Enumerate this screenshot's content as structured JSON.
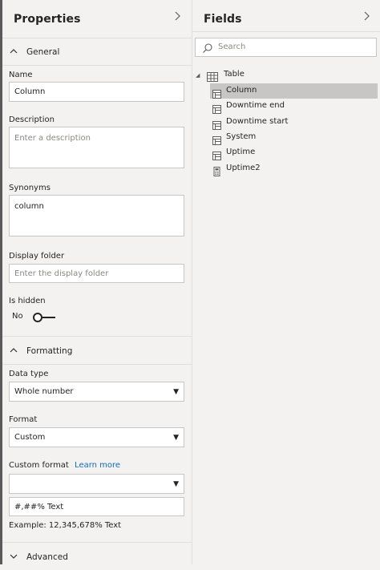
{
  "properties": {
    "title": "Properties",
    "general": {
      "header": "General",
      "name_label": "Name",
      "name_value": "Column",
      "description_label": "Description",
      "description_placeholder": "Enter a description",
      "synonyms_label": "Synonyms",
      "synonyms_value": "column",
      "display_folder_label": "Display folder",
      "display_folder_placeholder": "Enter the display folder",
      "is_hidden_label": "Is hidden",
      "is_hidden_value": "No"
    },
    "formatting": {
      "header": "Formatting",
      "data_type_label": "Data type",
      "data_type_value": "Whole number",
      "format_label": "Format",
      "format_value": "Custom",
      "custom_format_label": "Custom format",
      "learn_more_link": "Learn more",
      "custom_format_select_value": "",
      "custom_format_value": "#,##% Text",
      "example_text": "Example: 12,345,678% Text"
    },
    "advanced": {
      "header": "Advanced"
    }
  },
  "fields": {
    "title": "Fields",
    "search_placeholder": "Search",
    "table_name": "Table",
    "items": [
      {
        "name": "Column",
        "icon": "column-icon",
        "selected": true
      },
      {
        "name": "Downtime end",
        "icon": "column-icon",
        "selected": false
      },
      {
        "name": "Downtime start",
        "icon": "column-icon",
        "selected": false
      },
      {
        "name": "System",
        "icon": "column-icon",
        "selected": false
      },
      {
        "name": "Uptime",
        "icon": "column-icon",
        "selected": false
      },
      {
        "name": "Uptime2",
        "icon": "calculator-icon",
        "selected": false
      }
    ]
  }
}
